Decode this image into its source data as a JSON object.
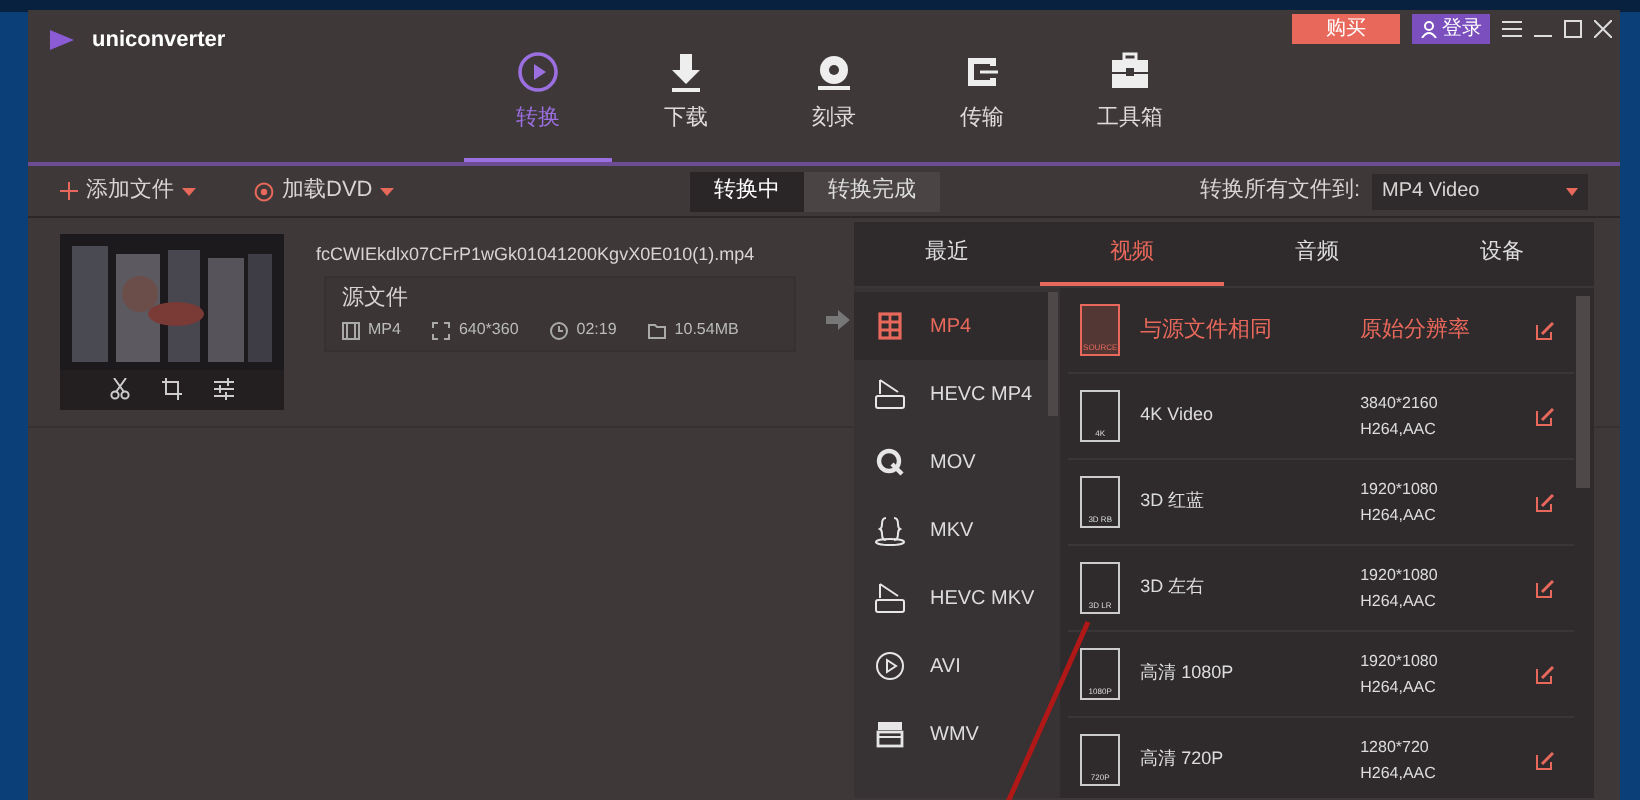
{
  "window": {
    "app_name": "uniconverter",
    "buy_label": "购买",
    "login_label": "登录"
  },
  "nav_tabs": [
    {
      "label": "转换",
      "kind": "convert",
      "selected": true
    },
    {
      "label": "下载",
      "kind": "download",
      "selected": false
    },
    {
      "label": "刻录",
      "kind": "burn",
      "selected": false
    },
    {
      "label": "传输",
      "kind": "transfer",
      "selected": false
    },
    {
      "label": "工具箱",
      "kind": "toolbox",
      "selected": false
    }
  ],
  "toolbar": {
    "add_file": "添加文件",
    "load_dvd": "加载DVD",
    "status_tabs": [
      {
        "label": "转换中",
        "selected": true
      },
      {
        "label": "转换完成",
        "selected": false
      }
    ],
    "convert_all_label": "转换所有文件到:",
    "output_format": "MP4 Video"
  },
  "file": {
    "name": "fcCWIEkdlx07CFrP1wGk01041200KgvX0E010(1).mp4",
    "source_label": "源文件",
    "format": "MP4",
    "resolution": "640*360",
    "duration": "02:19",
    "size": "10.54MB"
  },
  "format_panel": {
    "tabs": [
      {
        "label": "最近",
        "selected": false
      },
      {
        "label": "视频",
        "selected": true
      },
      {
        "label": "音频",
        "selected": false
      },
      {
        "label": "设备",
        "selected": false
      }
    ],
    "formats": [
      {
        "label": "MP4",
        "kind": "film",
        "selected": true
      },
      {
        "label": "HEVC MP4",
        "kind": "hevc",
        "selected": false
      },
      {
        "label": "MOV",
        "kind": "q",
        "selected": false
      },
      {
        "label": "MKV",
        "kind": "mkv",
        "selected": false
      },
      {
        "label": "HEVC MKV",
        "kind": "hevc",
        "selected": false
      },
      {
        "label": "AVI",
        "kind": "play",
        "selected": false
      },
      {
        "label": "WMV",
        "kind": "clapper",
        "selected": false
      }
    ],
    "presets": [
      {
        "name": "与源文件相同",
        "resolution": "原始分辨率",
        "badge": "SOURCE",
        "selected": true
      },
      {
        "name": "4K Video",
        "resolution": "3840*2160",
        "codec": "H264,AAC",
        "badge": "4K",
        "selected": false
      },
      {
        "name": "3D 红蓝",
        "resolution": "1920*1080",
        "codec": "H264,AAC",
        "badge": "3D RB",
        "selected": false
      },
      {
        "name": "3D 左右",
        "resolution": "1920*1080",
        "codec": "H264,AAC",
        "badge": "3D LR",
        "selected": false
      },
      {
        "name": "高清 1080P",
        "resolution": "1920*1080",
        "codec": "H264,AAC",
        "badge": "1080P",
        "selected": false
      },
      {
        "name": "高清 720P",
        "resolution": "1280*720",
        "codec": "H264,AAC",
        "badge": "720P",
        "selected": false
      }
    ]
  }
}
